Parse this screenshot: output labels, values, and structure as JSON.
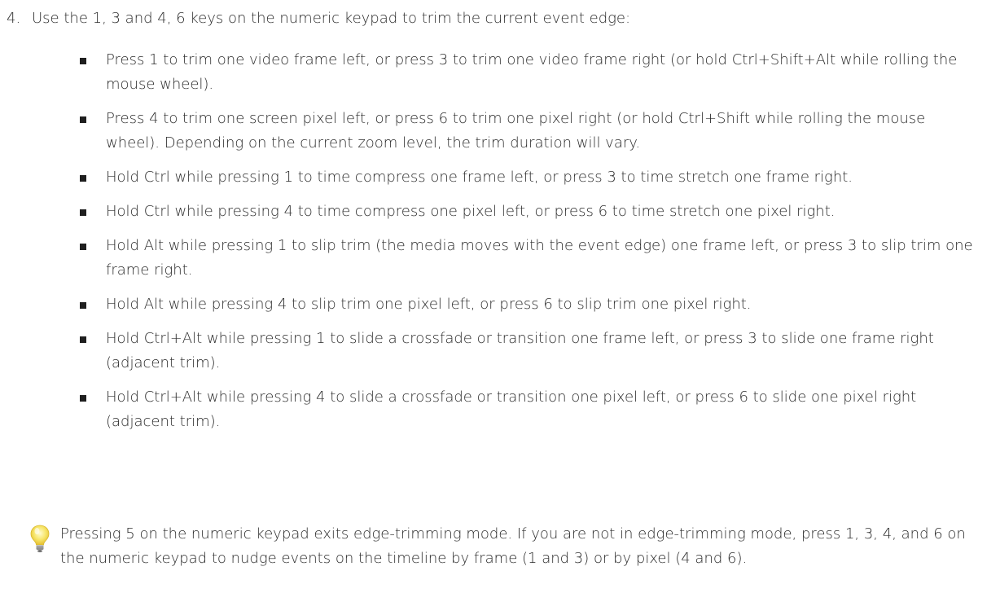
{
  "step": {
    "number": "4.",
    "text": "Use the 1, 3 and 4, 6 keys on the numeric keypad to trim the current event edge:"
  },
  "bullets": [
    "Press 1 to trim one video frame left, or press 3 to trim one video frame right (or hold Ctrl+Shift+Alt while rolling the mouse wheel).",
    "Press 4 to trim one screen pixel left, or press 6 to trim one pixel right (or hold Ctrl+Shift while rolling the mouse wheel). Depending on the current zoom level, the trim duration will vary.",
    "Hold Ctrl while pressing 1 to time compress one frame left, or press 3 to time stretch one frame right.",
    "Hold Ctrl while pressing 4 to time compress one pixel left, or press 6 to time stretch one pixel right.",
    "Hold Alt while pressing 1 to slip trim (the media moves with the event edge) one frame left, or press 3 to slip trim one frame right.",
    "Hold Alt while pressing 4 to slip trim one pixel left, or press 6 to slip trim one pixel right.",
    "Hold Ctrl+Alt while pressing 1 to slide a crossfade or transition one frame left, or press 3 to slide one frame right (adjacent trim).",
    "Hold Ctrl+Alt while pressing 4 to slide a crossfade or transition one pixel left, or press 6 to slide one pixel right (adjacent trim)."
  ],
  "tip": {
    "icon": "lightbulb-icon",
    "text": "Pressing 5 on the numeric keypad exits edge-trimming mode. If you are not in edge-trimming mode, press 1, 3, 4, and 6 on the numeric keypad to nudge events on the timeline by frame (1 and 3) or by pixel (4 and 6)."
  }
}
